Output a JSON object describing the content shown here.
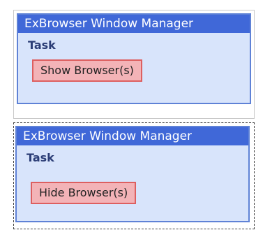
{
  "items": [
    {
      "header": "ExBrowser Window Manager",
      "task_label": "Task",
      "button_label": "Show Browser(s)"
    },
    {
      "header": "ExBrowser Window Manager",
      "task_label": "Task",
      "button_label": "Hide Browser(s)"
    }
  ],
  "colors": {
    "header_bg": "#4068d8",
    "card_bg": "#d8e4fb",
    "button_bg": "#f3b3b7",
    "button_border": "#dd5f60"
  }
}
